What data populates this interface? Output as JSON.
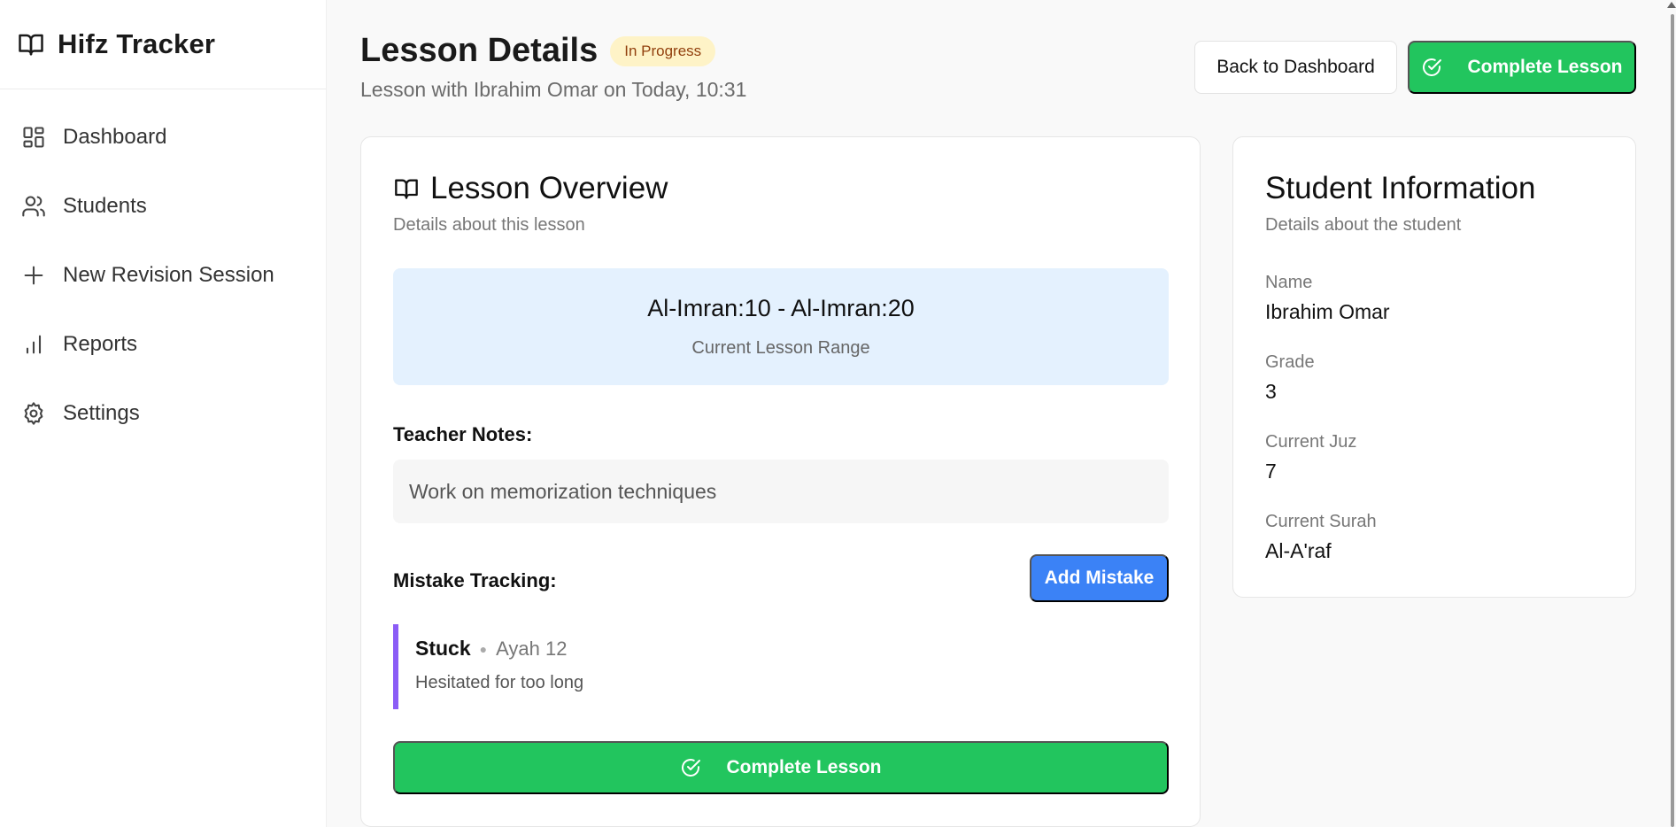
{
  "brand": {
    "title": "Hifz Tracker",
    "icon": "book-open-icon"
  },
  "sidebar": {
    "items": [
      {
        "label": "Dashboard",
        "icon": "dashboard-icon"
      },
      {
        "label": "Students",
        "icon": "users-icon"
      },
      {
        "label": "New Revision Session",
        "icon": "plus-icon"
      },
      {
        "label": "Reports",
        "icon": "bar-chart-icon"
      },
      {
        "label": "Settings",
        "icon": "gear-icon"
      }
    ]
  },
  "header": {
    "title": "Lesson Details",
    "status": "In Progress",
    "subtitle": "Lesson with Ibrahim Omar on Today, 10:31",
    "back_label": "Back to Dashboard",
    "complete_label": "Complete Lesson"
  },
  "overview": {
    "title": "Lesson Overview",
    "description": "Details about this lesson",
    "range": "Al-Imran:10 - Al-Imran:20",
    "range_label": "Current Lesson Range",
    "notes_label": "Teacher Notes:",
    "notes": "Work on memorization techniques",
    "mistakes_label": "Mistake Tracking:",
    "add_mistake_label": "Add Mistake",
    "mistakes": [
      {
        "type": "Stuck",
        "ayah": "Ayah 12",
        "description": "Hesitated for too long",
        "color": "#8b5cf6"
      }
    ],
    "complete_label": "Complete Lesson"
  },
  "student": {
    "title": "Student Information",
    "description": "Details about the student",
    "name_label": "Name",
    "name": "Ibrahim Omar",
    "grade_label": "Grade",
    "grade": "3",
    "juz_label": "Current Juz",
    "juz": "7",
    "surah_label": "Current Surah",
    "surah": "Al-A'raf"
  },
  "colors": {
    "success": "#22c55e",
    "primary": "#3b82f6",
    "badge_bg": "#fef3c7",
    "badge_text": "#92400e",
    "range_bg": "#e4f1fe"
  }
}
